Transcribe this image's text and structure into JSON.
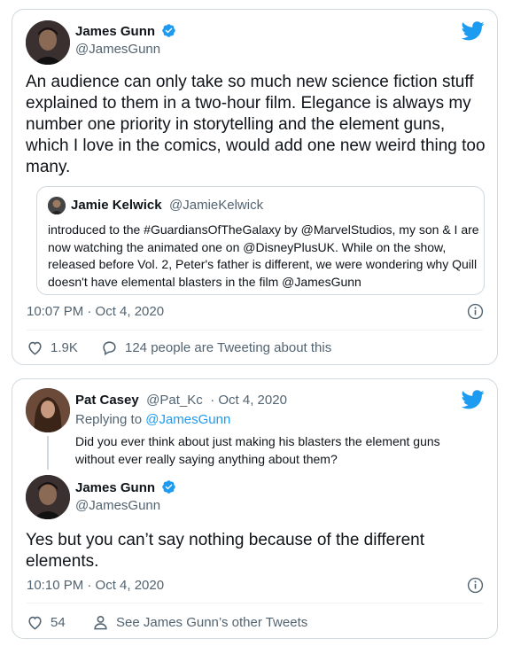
{
  "tweet1": {
    "author_name": "James Gunn",
    "author_handle": "@JamesGunn",
    "text": "An audience can only take so much new science fiction stuff explained to them in a two-hour film. Elegance is always my number one priority in storytelling and the element guns, which I love in the comics, would add one new weird thing too many.",
    "quote": {
      "author_name": "Jamie Kelwick",
      "author_handle": "@JamieKelwick",
      "text": "introduced to the #GuardiansOfTheGalaxy by @MarvelStudios, my son & I are now watching the animated one on @DisneyPlusUK. While on the show, released before Vol. 2, Peter's father is different, we were wondering why Quill doesn't have elemental blasters in the film @JamesGunn"
    },
    "timestamp": "10:07 PM · Oct 4, 2020",
    "like_count": "1.9K",
    "reply_label": "124 people are Tweeting about this"
  },
  "tweet2": {
    "parent": {
      "author_name": "Pat Casey",
      "author_handle": "@Pat_Kc",
      "date": "· Oct 4, 2020",
      "replying_prefix": "Replying to ",
      "replying_to": "@JamesGunn",
      "text": "Did you ever think about just making his blasters the element guns without ever really saying anything about them?"
    },
    "reply": {
      "author_name": "James Gunn",
      "author_handle": "@JamesGunn",
      "text": "Yes but you can’t say nothing because of the different elements.",
      "timestamp": "10:10 PM · Oct 4, 2020",
      "like_count": "54",
      "profile_label": "See James Gunn’s other Tweets"
    }
  },
  "colors": {
    "twitter_blue": "#1d9bf0",
    "text_primary": "#0f1419",
    "text_secondary": "#536471",
    "border": "#cfd9de"
  },
  "icons": [
    "twitter-bird-icon",
    "verified-badge-icon",
    "info-icon",
    "heart-icon",
    "reply-bubble-icon",
    "person-icon"
  ]
}
